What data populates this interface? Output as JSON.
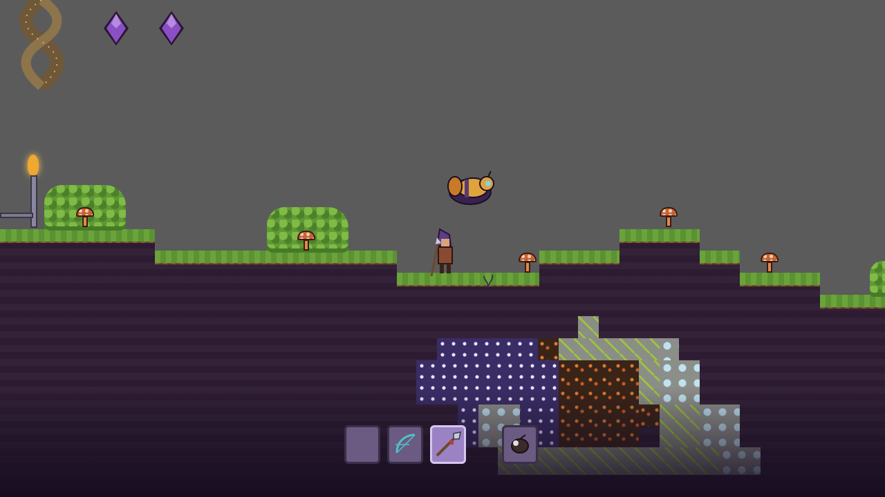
{
  "hud": {
    "gems": [
      {
        "icon": "amethyst-gem-icon",
        "color": "#8a4fc4"
      },
      {
        "icon": "amethyst-gem-icon",
        "color": "#8a4fc4"
      }
    ],
    "emblem_icon": "twisted-rope-emblem-icon"
  },
  "hotbar": {
    "slots": [
      {
        "icon": "",
        "selected": false
      },
      {
        "icon": "bow-icon",
        "selected": false
      },
      {
        "icon": "spear-icon",
        "selected": true
      }
    ],
    "extra_slot_icon": "beetle-item-icon"
  },
  "world": {
    "player": "hooded-spear-wielder",
    "enemy": "flying-golden-beetle",
    "sky_color": "#5b5b5b",
    "dirt_color": "#2f1e34",
    "grass_color": "#6aa33a"
  }
}
